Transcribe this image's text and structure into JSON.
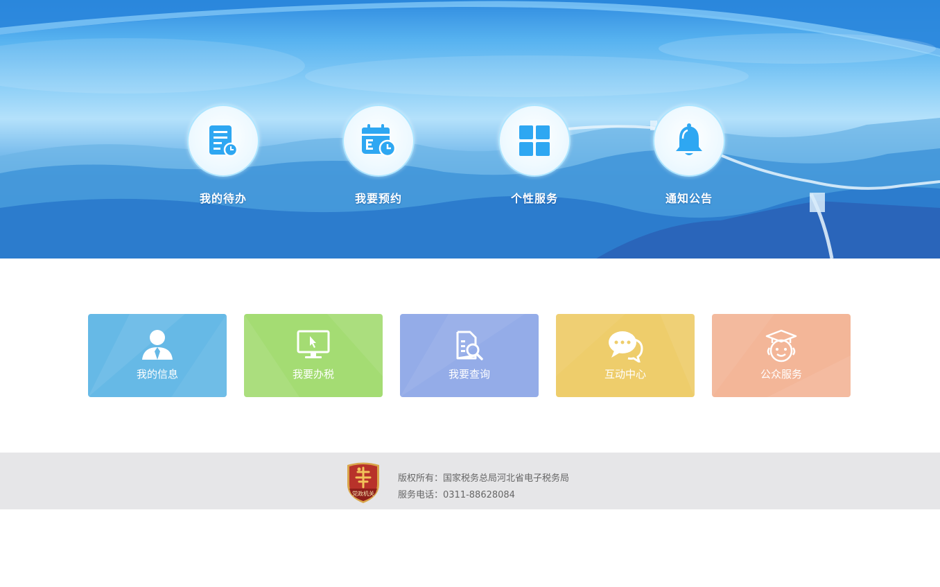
{
  "banner_nav": [
    {
      "label": "我的待办",
      "icon": "todo-list-icon"
    },
    {
      "label": "我要预约",
      "icon": "calendar-appointment-icon"
    },
    {
      "label": "个性服务",
      "icon": "grid-apps-icon"
    },
    {
      "label": "通知公告",
      "icon": "bell-icon"
    }
  ],
  "cards": [
    {
      "label": "我的信息",
      "icon": "user-icon",
      "color": "#66b9e6"
    },
    {
      "label": "我要办税",
      "icon": "monitor-cursor-icon",
      "color": "#a4dc73"
    },
    {
      "label": "我要查询",
      "icon": "document-search-icon",
      "color": "#94ace8"
    },
    {
      "label": "互动中心",
      "icon": "chat-bubble-icon",
      "color": "#eecd6b"
    },
    {
      "label": "公众服务",
      "icon": "customer-service-icon",
      "color": "#f3b698"
    }
  ],
  "footer": {
    "copyright": "版权所有：国家税务总局河北省电子税务局",
    "phone": "服务电话：0311-88628084",
    "emblem_text": "党政机关"
  },
  "colors": {
    "icon_blue": "#2ea7f2",
    "footer_bg": "#e6e6e8",
    "emblem_red": "#b8322a"
  }
}
